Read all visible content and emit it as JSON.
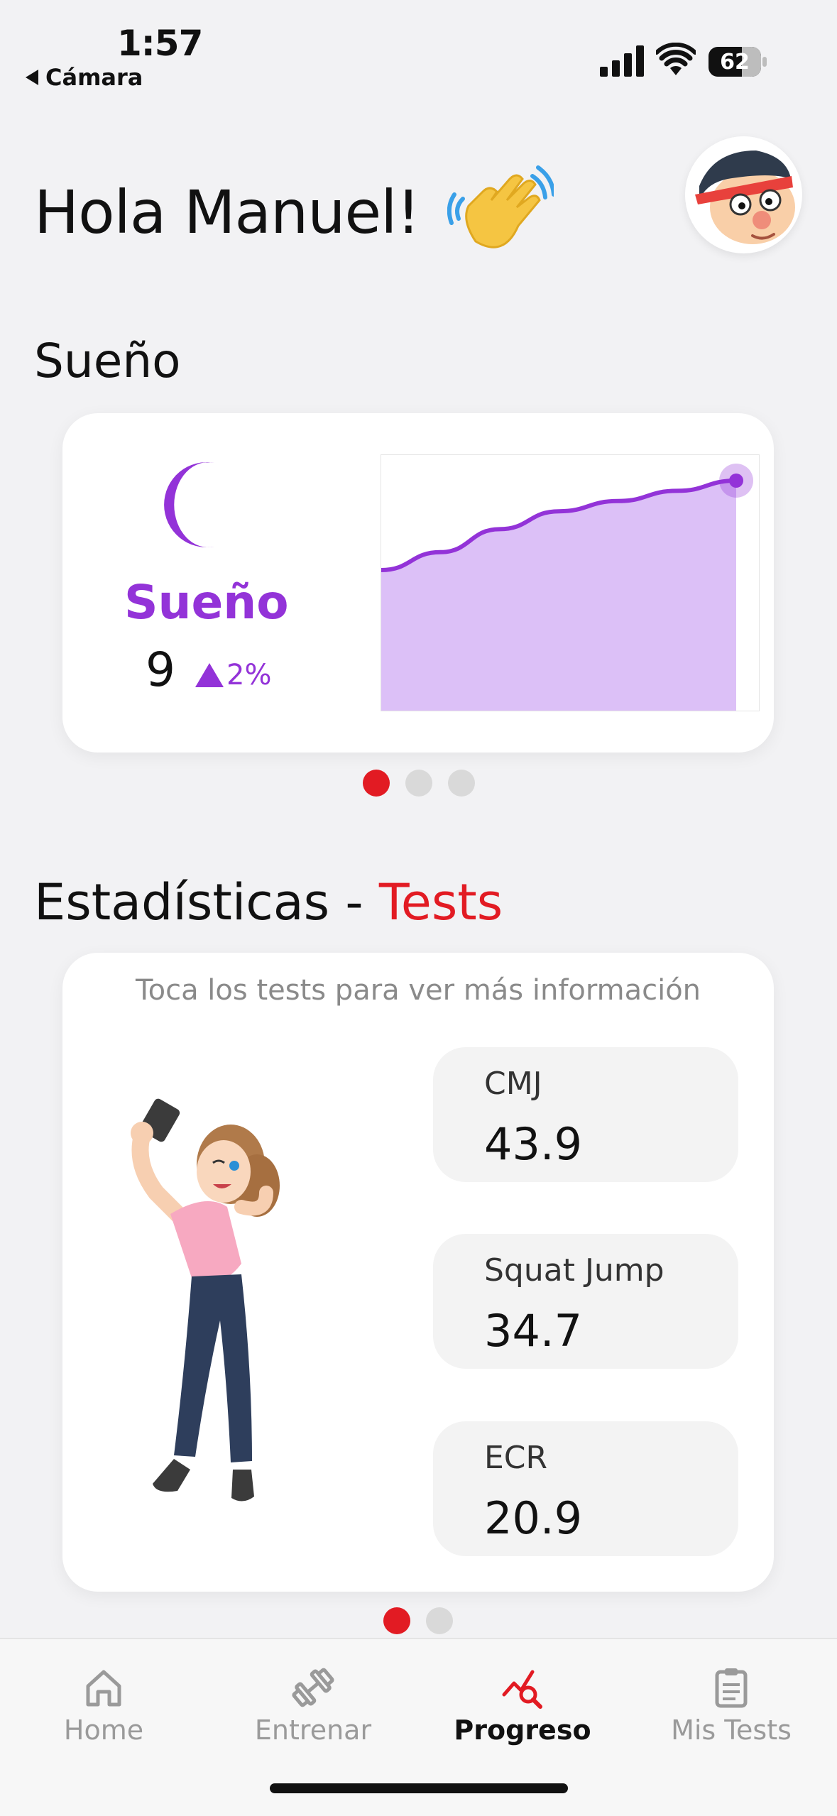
{
  "status_bar": {
    "time": "1:57",
    "back_label": "Cámara",
    "battery": "62"
  },
  "header": {
    "greeting": "Hola Manuel!",
    "wave_icon": "waving-hand-icon",
    "avatar_icon": "cartoon-avatar"
  },
  "sleep": {
    "section_title": "Sueño",
    "card_label": "Sueño",
    "value": "9",
    "trend": "2%",
    "accent": "#9333d8",
    "fill": "#dcc0f7",
    "chart_data": {
      "type": "area",
      "values": [
        5.5,
        6.2,
        7.1,
        7.8,
        8.2,
        8.6,
        9.0
      ]
    },
    "carousel": {
      "count": 3,
      "active": 0
    }
  },
  "stats": {
    "title_prefix": "Estadísticas - ",
    "title_highlight": "Tests",
    "hint": "Toca los tests para ver más información",
    "tests": [
      {
        "name": "CMJ",
        "value": "43.9"
      },
      {
        "name": "Squat Jump",
        "value": "34.7"
      },
      {
        "name": "ECR",
        "value": "20.9"
      }
    ],
    "carousel": {
      "count": 2,
      "active": 0
    }
  },
  "nav": {
    "items": [
      {
        "label": "Home",
        "icon": "home-icon"
      },
      {
        "label": "Entrenar",
        "icon": "dumbbell-icon"
      },
      {
        "label": "Progreso",
        "icon": "progress-chart-icon"
      },
      {
        "label": "Mis Tests",
        "icon": "clipboard-icon"
      }
    ],
    "active": 2
  },
  "colors": {
    "brand_red": "#e21b23",
    "background": "#f2f2f4"
  }
}
